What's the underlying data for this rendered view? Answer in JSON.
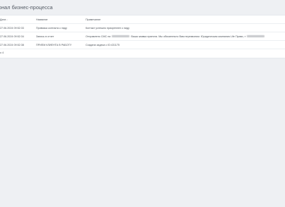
{
  "page": {
    "title": "онал бизнес-процесса"
  },
  "table": {
    "headers": {
      "date": "Дата",
      "name": "Название",
      "note": "Примечание"
    },
    "rows": [
      {
        "date": "27.06.2024 09:52:33",
        "name": "Привязка контакта к лиду",
        "note": "Контакт успешно прикреплен к лиду"
      },
      {
        "date": "27.06.2024 09:52:34",
        "name": "Запись в отчет",
        "note_before": "Отправлено СМС на",
        "note_after": "Ваша заявка принята. Мы обязательно Вам перезвоним. Юридическая компания Life Право, т"
      },
      {
        "date": "27.06.2024 09:52:38",
        "name": "ПРИЕМ КЛИЕНТА В РАБОТУ",
        "note": "Создана задача с ID:431175"
      }
    ],
    "total": "о 4"
  }
}
